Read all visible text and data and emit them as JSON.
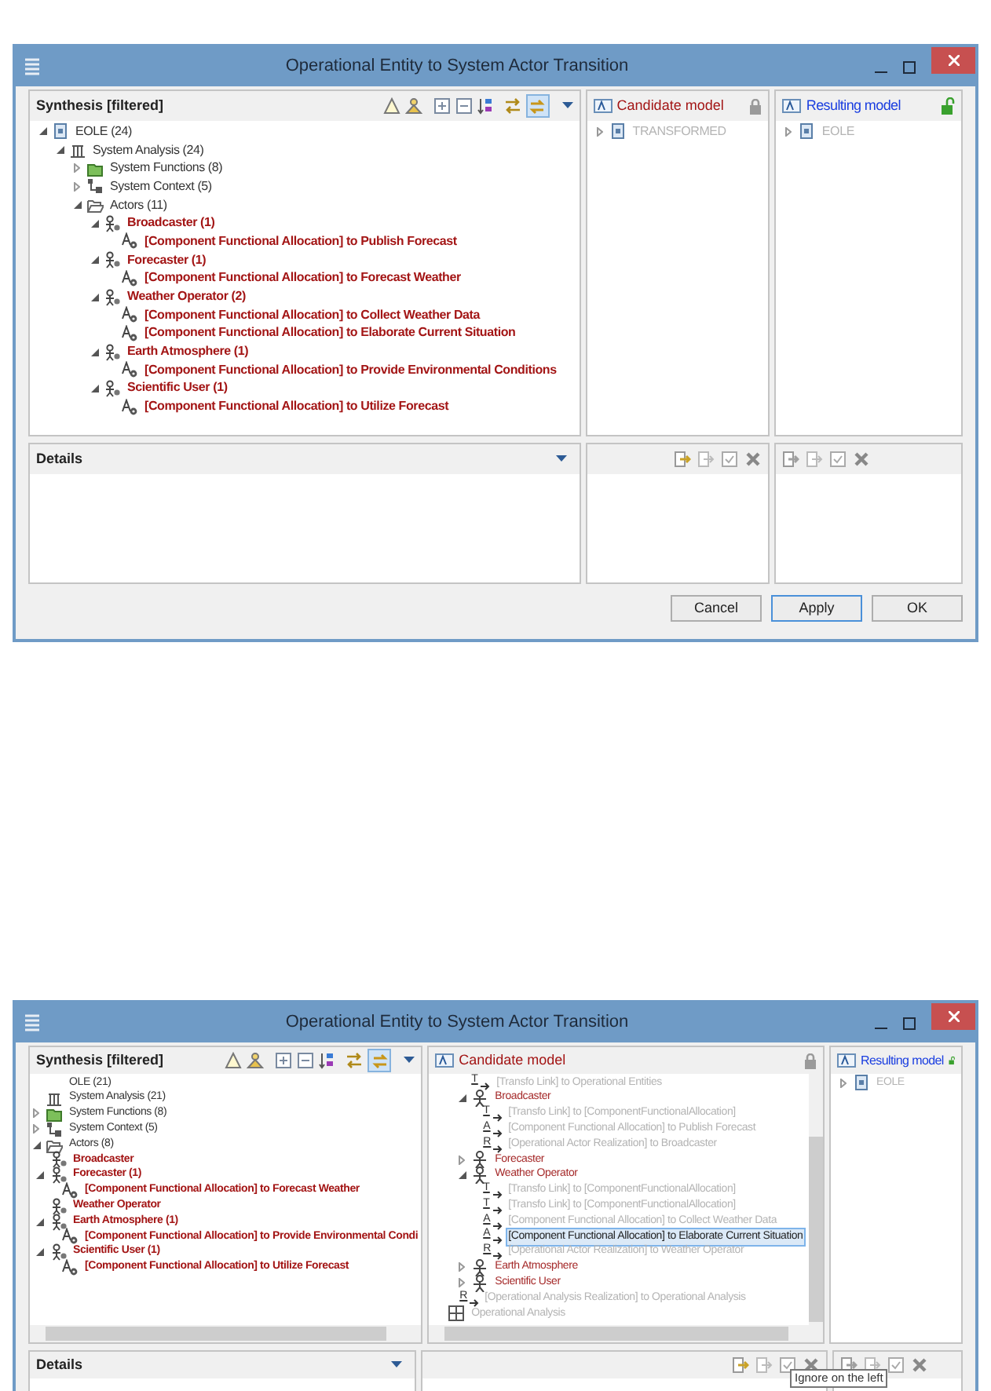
{
  "dialogs": [
    {
      "title": "Operational Entity to System Actor Transition",
      "synthesis": {
        "title": "Synthesis [filtered]",
        "tree": [
          {
            "label": "EOLE (24)",
            "expanded": true,
            "kind": "model",
            "children": [
              {
                "label": "System Analysis (24)",
                "expanded": true,
                "kind": "analysis",
                "children": [
                  {
                    "label": "System Functions (8)",
                    "expanded": false,
                    "kind": "functions"
                  },
                  {
                    "label": "System Context (5)",
                    "expanded": false,
                    "kind": "context"
                  },
                  {
                    "label": "Actors (11)",
                    "expanded": true,
                    "kind": "folder",
                    "children": [
                      {
                        "label": "Broadcaster (1)",
                        "expanded": true,
                        "kind": "actor",
                        "children": [
                          {
                            "label": "[Component Functional Allocation] to Publish Forecast",
                            "kind": "allocation"
                          }
                        ]
                      },
                      {
                        "label": "Forecaster (1)",
                        "expanded": true,
                        "kind": "actor",
                        "children": [
                          {
                            "label": "[Component Functional Allocation] to Forecast Weather",
                            "kind": "allocation"
                          }
                        ]
                      },
                      {
                        "label": "Weather Operator (2)",
                        "expanded": true,
                        "kind": "actor",
                        "children": [
                          {
                            "label": "[Component Functional Allocation] to Collect Weather Data",
                            "kind": "allocation"
                          },
                          {
                            "label": "[Component Functional Allocation] to Elaborate Current Situation",
                            "kind": "allocation"
                          }
                        ]
                      },
                      {
                        "label": "Earth Atmosphere (1)",
                        "expanded": true,
                        "kind": "actor",
                        "children": [
                          {
                            "label": "[Component Functional Allocation] to Provide Environmental Conditions",
                            "kind": "allocation"
                          }
                        ]
                      },
                      {
                        "label": "Scientific User (1)",
                        "expanded": true,
                        "kind": "actor",
                        "children": [
                          {
                            "label": "[Component Functional Allocation] to Utilize Forecast",
                            "kind": "allocation"
                          }
                        ]
                      }
                    ]
                  }
                ]
              }
            ]
          }
        ]
      },
      "candidate": {
        "title": "Candidate model",
        "locked": true,
        "tree": [
          {
            "label": "TRANSFORMED",
            "expanded": false,
            "kind": "model",
            "disabled": true
          }
        ]
      },
      "resulting": {
        "title": "Resulting model",
        "locked": false,
        "tree": [
          {
            "label": "EOLE",
            "expanded": false,
            "kind": "model",
            "disabled": true
          }
        ]
      },
      "details": {
        "title": "Details"
      },
      "buttons": [
        {
          "label": "Cancel",
          "focused": false
        },
        {
          "label": "Apply",
          "focused": true
        },
        {
          "label": "OK",
          "focused": false
        }
      ]
    },
    {
      "title": "Operational Entity to System Actor Transition",
      "synthesis": {
        "title": "Synthesis [filtered]",
        "tree": [
          {
            "label": "OLE (21)",
            "kind": "text",
            "children": [
              {
                "label": "System Analysis (21)",
                "kind": "analysis",
                "children": [
                  {
                    "label": "System Functions (8)",
                    "expanded": false,
                    "kind": "functions"
                  },
                  {
                    "label": "System Context (5)",
                    "expanded": false,
                    "kind": "context"
                  },
                  {
                    "label": "Actors (8)",
                    "expanded": true,
                    "kind": "folder",
                    "children": [
                      {
                        "label": "Broadcaster",
                        "kind": "actor"
                      },
                      {
                        "label": "Forecaster (1)",
                        "expanded": true,
                        "kind": "actor",
                        "children": [
                          {
                            "label": "[Component Functional Allocation] to Forecast Weather",
                            "kind": "allocation"
                          }
                        ]
                      },
                      {
                        "label": "Weather Operator",
                        "kind": "actor"
                      },
                      {
                        "label": "Earth Atmosphere (1)",
                        "expanded": true,
                        "kind": "actor",
                        "children": [
                          {
                            "label": "[Component Functional Allocation] to Provide Environmental Condi",
                            "kind": "allocation"
                          }
                        ]
                      },
                      {
                        "label": "Scientific User (1)",
                        "expanded": true,
                        "kind": "actor",
                        "children": [
                          {
                            "label": "[Component Functional Allocation] to Utilize Forecast",
                            "kind": "allocation"
                          }
                        ]
                      }
                    ]
                  }
                ]
              }
            ]
          }
        ]
      },
      "candidate": {
        "title": "Candidate model",
        "locked": true,
        "tree": [
          {
            "children": [
              {
                "children": [
                  {
                    "label": "[Transfo Link] to Operational Entities",
                    "badge": "T",
                    "kind": "link",
                    "disabled": true,
                    "selected": false
                  },
                  {
                    "label": "Broadcaster",
                    "expanded": true,
                    "kind": "person",
                    "disabled": false,
                    "selected": false,
                    "children": [
                      {
                        "label": "[Transfo Link] to [ComponentFunctionalAllocation]",
                        "badge": "T",
                        "kind": "link",
                        "disabled": true,
                        "selected": false
                      },
                      {
                        "label": "[Component Functional Allocation] to Publish Forecast",
                        "badge": "A",
                        "kind": "link",
                        "disabled": true,
                        "selected": false
                      },
                      {
                        "label": "[Operational Actor Realization] to Broadcaster",
                        "badge": "R",
                        "kind": "link",
                        "disabled": true,
                        "selected": false
                      }
                    ]
                  },
                  {
                    "label": "Forecaster",
                    "expanded": false,
                    "kind": "person",
                    "disabled": false,
                    "selected": false
                  },
                  {
                    "label": "Weather Operator",
                    "expanded": true,
                    "kind": "person",
                    "disabled": false,
                    "selected": false,
                    "children": [
                      {
                        "label": "[Transfo Link] to [ComponentFunctionalAllocation]",
                        "badge": "T",
                        "kind": "link",
                        "disabled": true,
                        "selected": false
                      },
                      {
                        "label": "[Transfo Link] to [ComponentFunctionalAllocation]",
                        "badge": "T",
                        "kind": "link",
                        "disabled": true,
                        "selected": false
                      },
                      {
                        "label": "[Component Functional Allocation] to Collect Weather Data",
                        "badge": "A",
                        "kind": "link",
                        "disabled": true,
                        "selected": false
                      },
                      {
                        "label": "[Component Functional Allocation] to Elaborate Current Situation",
                        "badge": "A",
                        "kind": "link",
                        "disabled": false,
                        "selected": true
                      },
                      {
                        "label": "[Operational Actor Realization] to Weather Operator",
                        "badge": "R",
                        "kind": "link",
                        "disabled": true,
                        "selected": false
                      }
                    ]
                  },
                  {
                    "label": "Earth Atmosphere",
                    "expanded": false,
                    "kind": "person",
                    "disabled": false,
                    "selected": false
                  },
                  {
                    "label": "Scientific User",
                    "expanded": false,
                    "kind": "person",
                    "disabled": false,
                    "selected": false
                  }
                ]
              },
              {
                "label": "[Operational Analysis Realization] to Operational Analysis",
                "badge": "R",
                "kind": "link",
                "disabled": true,
                "selected": false
              }
            ]
          },
          {
            "label": "Operational Analysis",
            "kind": "grid",
            "disabled": true,
            "selected": false
          }
        ]
      },
      "resulting": {
        "title": "Resulting model",
        "locked": false,
        "tree": [
          {
            "label": "EOLE",
            "expanded": false,
            "kind": "model",
            "disabled": true
          }
        ]
      },
      "details": {
        "title": "Details"
      },
      "tooltip": "Ignore on the left"
    }
  ]
}
